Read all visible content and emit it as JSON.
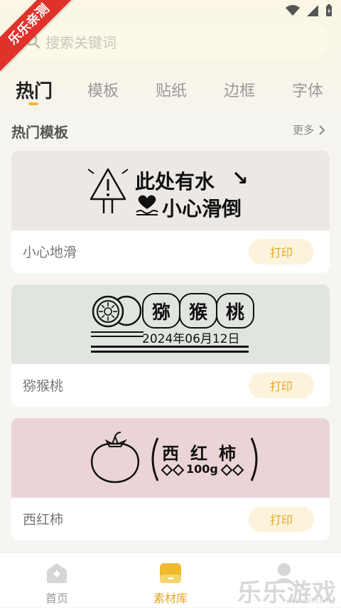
{
  "badge": {
    "text": "乐乐亲测"
  },
  "search": {
    "placeholder": "搜索关键词"
  },
  "tabs": [
    {
      "label": "热门",
      "active": true
    },
    {
      "label": "模板",
      "active": false
    },
    {
      "label": "贴纸",
      "active": false
    },
    {
      "label": "边框",
      "active": false
    },
    {
      "label": "字体",
      "active": false
    }
  ],
  "section": {
    "title": "热门模板",
    "more_label": "更多"
  },
  "cards": [
    {
      "name": "小心地滑",
      "print_label": "打印",
      "bg": "#ece8e5",
      "art": {
        "line1": "此处有水",
        "line2": "小心滑倒",
        "arrow": "↘"
      }
    },
    {
      "name": "猕猴桃",
      "print_label": "打印",
      "bg": "#e0e5df",
      "art": {
        "chars": [
          "猕",
          "猴",
          "桃"
        ],
        "date": "2024年06月12日"
      }
    },
    {
      "name": "西红柿",
      "print_label": "打印",
      "bg": "#ebd4d6",
      "art": {
        "chars": [
          "西",
          "红",
          "柿"
        ],
        "weight": "100g"
      }
    }
  ],
  "nav": [
    {
      "label": "首页",
      "icon": "home-icon",
      "active": false
    },
    {
      "label": "素材库",
      "icon": "library-icon",
      "active": true
    },
    {
      "label": "",
      "icon": "profile-icon",
      "active": false
    }
  ],
  "watermark": {
    "text": "乐乐游戏",
    "url": "www.6ll.com"
  },
  "colors": {
    "accent": "#f0b92e",
    "print_text": "#e3a623",
    "print_bg": "#fdf3dc"
  }
}
